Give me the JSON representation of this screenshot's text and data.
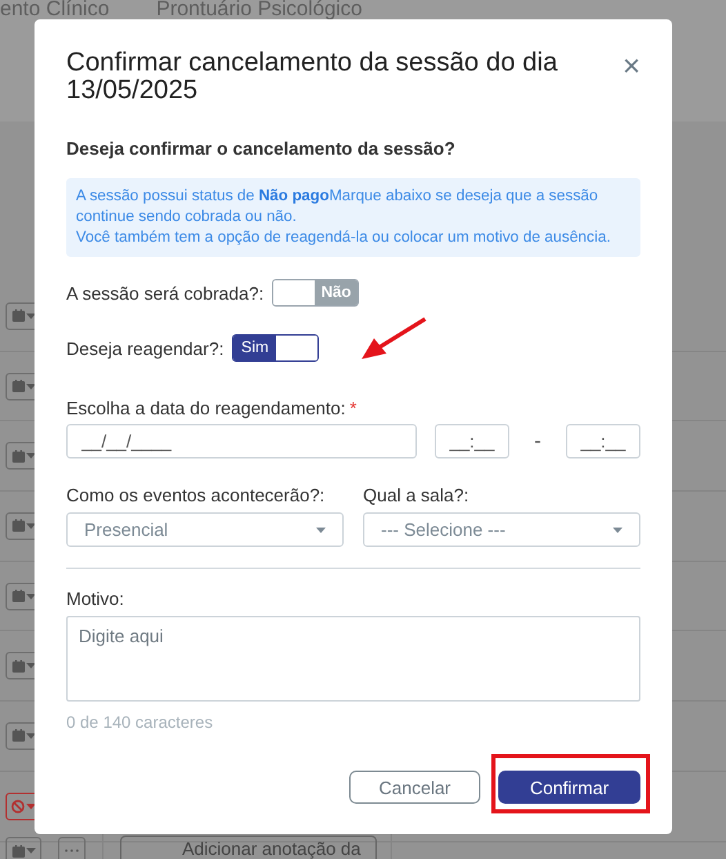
{
  "background": {
    "tabs": [
      {
        "label": "ento Clínico"
      },
      {
        "label": "Prontuário Psicológico"
      }
    ],
    "row_actions": [
      {
        "kind": "calendar"
      },
      {
        "kind": "calendar"
      },
      {
        "kind": "calendar"
      },
      {
        "kind": "calendar"
      },
      {
        "kind": "calendar"
      },
      {
        "kind": "calendar"
      },
      {
        "kind": "calendar"
      },
      {
        "kind": "blocked"
      }
    ],
    "note_button": "Adicionar anotação da"
  },
  "dialog": {
    "title": "Confirmar cancelamento da sessão do dia 13/05/2025",
    "close": "×",
    "question": "Deseja confirmar o cancelamento da sessão?",
    "info": [
      "A sessão possui status de **Não pago**Marque abaixo se deseja que a sessão continue sendo cobrada ou não.",
      "Você também tem a opção de reagendá-la ou colocar um motivo de ausência."
    ],
    "toggles": [
      {
        "label": "A sessão será cobrada?:",
        "on": false,
        "text": "Não",
        "pointed": false
      },
      {
        "label": "Deseja reagendar?:",
        "on": true,
        "text": "Sim",
        "pointed": true
      }
    ],
    "date": {
      "label": "Escolha a data do reagendamento:",
      "required": true,
      "required_mark": "*",
      "placeholder": "__/__/____",
      "start": {
        "placeholder": "__:__"
      },
      "separator": "-",
      "end": {
        "placeholder": "__:__"
      }
    },
    "selects": [
      {
        "label": "Como os eventos acontecerão?:",
        "value": "Presencial"
      },
      {
        "label": "Qual a sala?:",
        "placeholder": "--- Selecione ---"
      }
    ],
    "reason": {
      "label": "Motivo:",
      "placeholder": "Digite aqui",
      "counter": "0 de 140 caracteres"
    },
    "buttons": [
      {
        "label": "Cancelar",
        "kind": "secondary",
        "highlighted": false
      },
      {
        "label": "Confirmar",
        "kind": "primary",
        "highlighted": true
      }
    ]
  }
}
